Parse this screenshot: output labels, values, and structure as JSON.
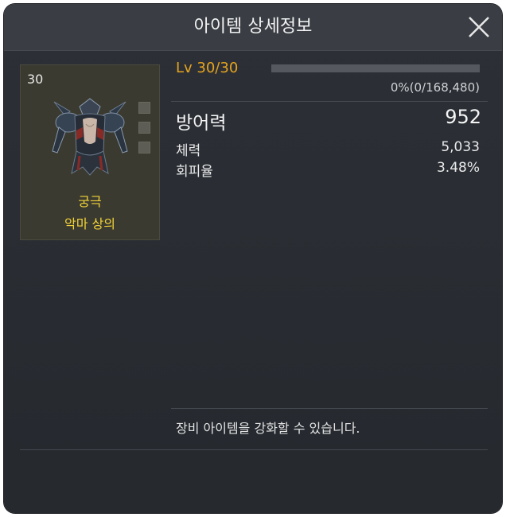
{
  "dialog": {
    "title": "아이템 상세정보"
  },
  "item": {
    "level": "30",
    "class": "궁극",
    "name": "악마 상의",
    "image_icon": "demon-armor-top-icon",
    "slots": 3
  },
  "enhancement": {
    "level_text": "Lv 30/30",
    "exp_text": "0%(0/168,480)",
    "exp_percent": 0
  },
  "stats": {
    "main": {
      "label": "방어력",
      "value": "952"
    },
    "list": [
      {
        "label": "체력",
        "value": "5,033"
      },
      {
        "label": "회피율",
        "value": "3.48%"
      }
    ]
  },
  "note": "장비 아이템을 강화할 수 있습니다.",
  "colors": {
    "accent": "#e6a31e",
    "item_name": "#f0d23a",
    "panel": "#2c3036"
  }
}
